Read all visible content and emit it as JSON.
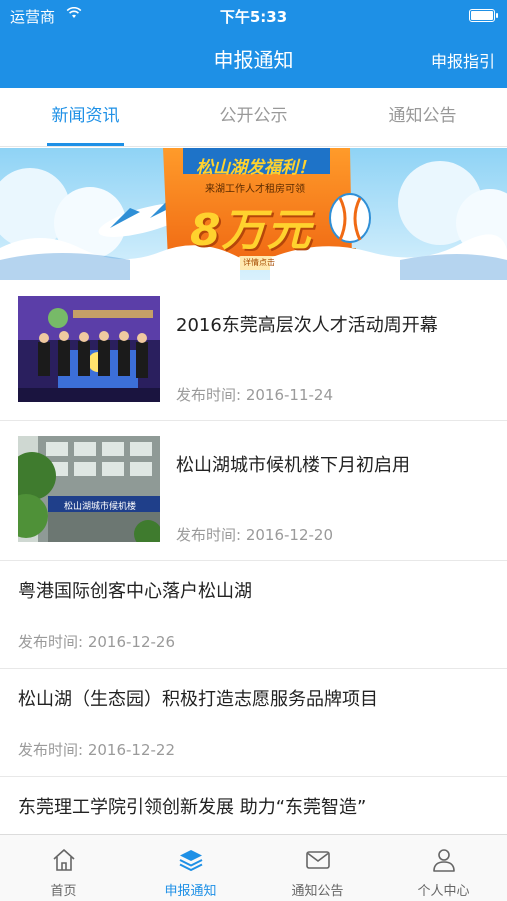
{
  "status_bar": {
    "carrier": "运营商",
    "time": "下午5:33"
  },
  "nav": {
    "title": "申报通知",
    "right_link": "申报指引"
  },
  "tabs": [
    {
      "label": "新闻资讯",
      "active": true
    },
    {
      "label": "公开公示",
      "active": false
    },
    {
      "label": "通知公告",
      "active": false
    }
  ],
  "banner": {
    "headline": "松山湖发福利！",
    "subline": "来湖工作人才租房可领",
    "amount": "8万元",
    "button": "详情点击"
  },
  "news": [
    {
      "title": "2016东莞高层次人才活动周开幕",
      "date": "发布时间: 2016-11-24",
      "has_thumb": true
    },
    {
      "title": "松山湖城市候机楼下月初启用",
      "date": "发布时间: 2016-12-20",
      "has_thumb": true,
      "thumb_sign": "松山湖城市候机楼"
    },
    {
      "title": "粤港国际创客中心落户松山湖",
      "date": "发布时间: 2016-12-26",
      "has_thumb": false
    },
    {
      "title": "松山湖（生态园）积极打造志愿服务品牌项目",
      "date": "发布时间: 2016-12-22",
      "has_thumb": false
    },
    {
      "title": "东莞理工学院引领创新发展 助力“东莞智造”",
      "date": "",
      "has_thumb": false
    }
  ],
  "tabbar": [
    {
      "label": "首页",
      "icon": "home-icon",
      "active": false
    },
    {
      "label": "申报通知",
      "icon": "layers-icon",
      "active": true
    },
    {
      "label": "通知公告",
      "icon": "mail-icon",
      "active": false
    },
    {
      "label": "个人中心",
      "icon": "person-icon",
      "active": false
    }
  ],
  "colors": {
    "primary": "#1e90e6",
    "text": "#222222",
    "muted": "#9a9a9a",
    "banner_orange": "#f28a1e",
    "banner_gold": "#ffd22e"
  }
}
